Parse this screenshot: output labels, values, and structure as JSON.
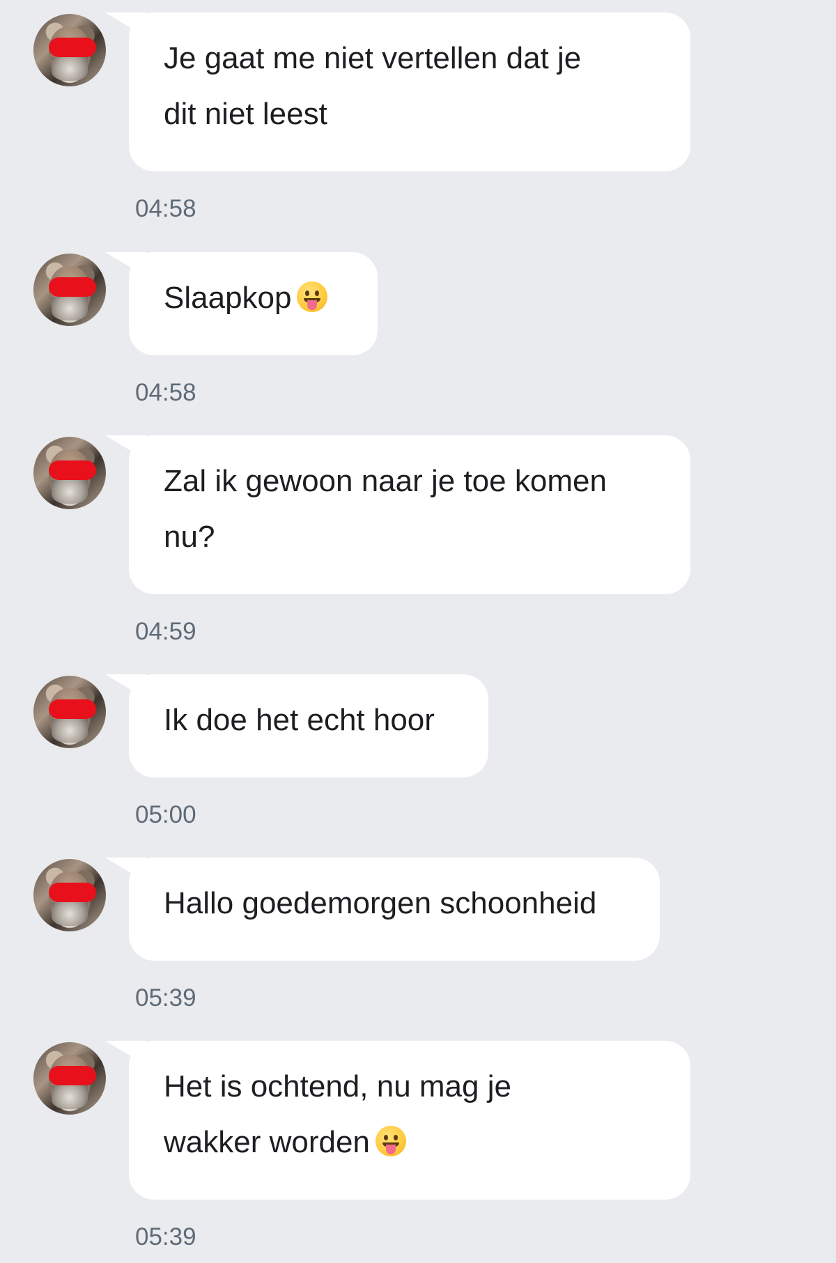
{
  "conversation": {
    "messages": [
      {
        "lines": [
          "Je gaat me niet vertellen dat je",
          "dit niet leest"
        ],
        "time": "04:58",
        "emoji": null
      },
      {
        "lines": [
          "Slaapkop"
        ],
        "time": "04:58",
        "emoji": "face-with-tongue-icon"
      },
      {
        "lines": [
          "Zal ik gewoon naar je toe komen",
          "nu?"
        ],
        "time": "04:59",
        "emoji": null
      },
      {
        "lines": [
          "Ik doe het echt hoor"
        ],
        "time": "05:00",
        "emoji": null
      },
      {
        "lines": [
          "Hallo goedemorgen schoonheid"
        ],
        "time": "05:39",
        "emoji": null
      },
      {
        "lines": [
          "Het is ochtend, nu mag je",
          "wakker worden"
        ],
        "time": "05:39",
        "emoji": "face-with-tongue-icon"
      }
    ]
  },
  "colors": {
    "background": "#e9ebee",
    "bubble": "#ffffff",
    "text": "#1c1e21",
    "timestamp": "#5f6b77",
    "censor_bar": "#e8101a"
  }
}
